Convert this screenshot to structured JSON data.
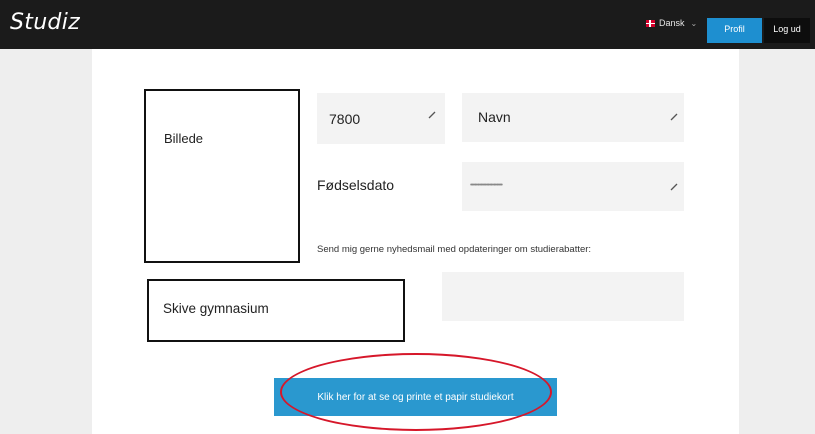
{
  "header": {
    "logo": "Studiz",
    "language": "Dansk",
    "profile_button": "Profil",
    "logout_button": "Log ud"
  },
  "profile": {
    "photo_label": "Billede",
    "zip_value": "7800",
    "name_value": "Navn",
    "dob_label": "Fødselsdato",
    "dob_value": "••••••••••••••••••••••",
    "newsletter_text": "Send mig gerne nyhedsmail med opdateringer om studierabatter:",
    "school": "Skive gymnasium"
  },
  "actions": {
    "print_card": "Klik her for at se og printe et papir studiekort"
  },
  "colors": {
    "header_bg": "#1b1b1b",
    "accent": "#2a98cf",
    "annotation": "#d6172a"
  },
  "icons": [
    "pencil-icon",
    "danish-flag-icon",
    "chevron-down-icon"
  ]
}
